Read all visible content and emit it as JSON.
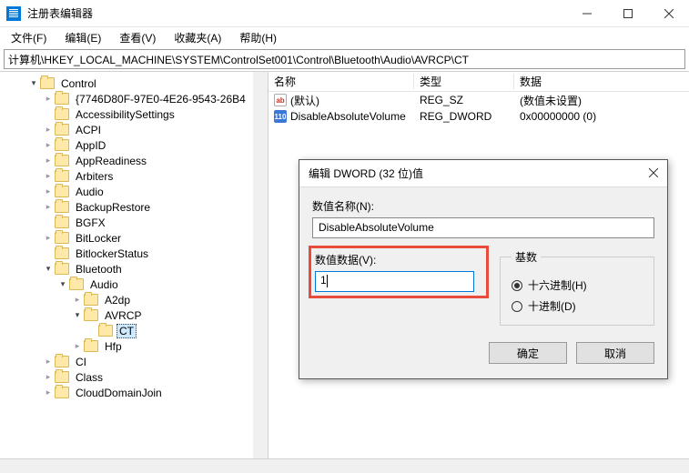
{
  "window": {
    "title": "注册表编辑器"
  },
  "menu": {
    "file": "文件(F)",
    "edit": "编辑(E)",
    "view": "查看(V)",
    "fav": "收藏夹(A)",
    "help": "帮助(H)"
  },
  "addr": "计算机\\HKEY_LOCAL_MACHINE\\SYSTEM\\ControlSet001\\Control\\Bluetooth\\Audio\\AVRCP\\CT",
  "tree": {
    "control": "Control",
    "items": [
      "{7746D80F-97E0-4E26-9543-26B4",
      "AccessibilitySettings",
      "ACPI",
      "AppID",
      "AppReadiness",
      "Arbiters",
      "Audio",
      "BackupRestore",
      "BGFX",
      "BitLocker",
      "BitlockerStatus"
    ],
    "bluetooth": "Bluetooth",
    "bt_audio": "Audio",
    "audio_children": [
      "A2dp",
      "AVRCP"
    ],
    "ct": "CT",
    "hfp": "Hfp",
    "tail": [
      "CI",
      "Class",
      "CloudDomainJoin"
    ]
  },
  "list": {
    "cols": {
      "name": "名称",
      "type": "类型",
      "data": "数据"
    },
    "rows": [
      {
        "name": "(默认)",
        "type": "REG_SZ",
        "data": "(数值未设置)",
        "icon": "sz"
      },
      {
        "name": "DisableAbsoluteVolume",
        "type": "REG_DWORD",
        "data": "0x00000000 (0)",
        "icon": "dw"
      }
    ]
  },
  "dialog": {
    "title": "编辑 DWORD (32 位)值",
    "name_label": "数值名称(N):",
    "name_value": "DisableAbsoluteVolume",
    "data_label": "数值数据(V):",
    "data_value": "1",
    "base_label": "基数",
    "hex": "十六进制(H)",
    "dec": "十进制(D)",
    "ok": "确定",
    "cancel": "取消"
  },
  "icons": {
    "sz": "ab",
    "dw": "110"
  }
}
